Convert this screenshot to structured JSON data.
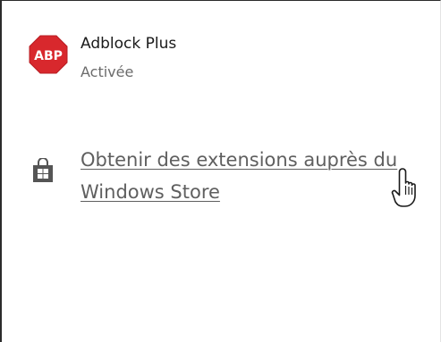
{
  "extension": {
    "name": "Adblock Plus",
    "status": "Activée",
    "icon": "abp-icon",
    "icon_label": "ABP",
    "icon_color": "#d8282d"
  },
  "store_link": {
    "line1": "Obtenir des extensions auprès du",
    "line2": "Windows Store",
    "icon": "store-bag-icon"
  },
  "cursor": "hand-pointer-icon"
}
